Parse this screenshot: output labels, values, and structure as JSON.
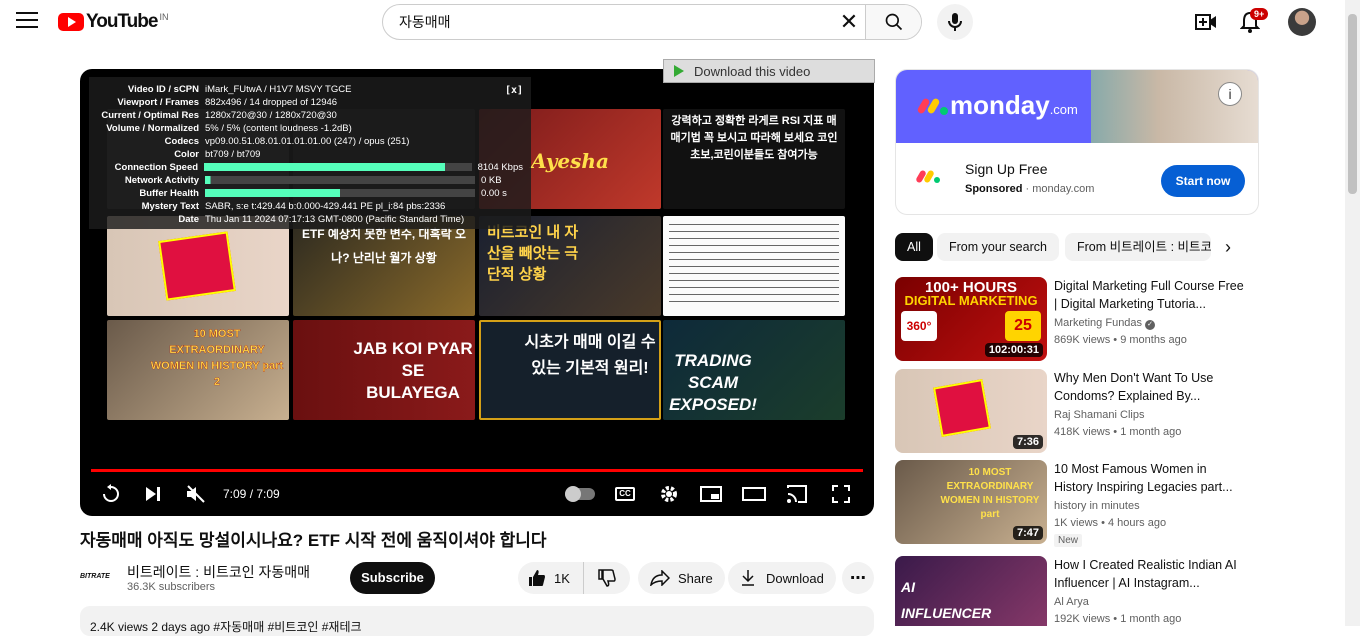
{
  "header": {
    "logo_text": "YouTube",
    "country": "IN",
    "search_value": "자동매매",
    "notification_count": "9+"
  },
  "player": {
    "stats": [
      {
        "key": "Video ID / sCPN",
        "val": "iMark_FUtwA / H1V7 MSVY TGCE"
      },
      {
        "key": "Viewport / Frames",
        "val": "882x496 / 14 dropped of 12946"
      },
      {
        "key": "Current / Optimal Res",
        "val": "1280x720@30 / 1280x720@30"
      },
      {
        "key": "Volume / Normalized",
        "val": "5% / 5% (content loudness -1.2dB)"
      },
      {
        "key": "Codecs",
        "val": "vp09.00.51.08.01.01.01.01.00 (247) / opus (251)"
      },
      {
        "key": "Color",
        "val": "bt709 / bt709"
      },
      {
        "key": "Connection Speed",
        "val": "8104 Kbps"
      },
      {
        "key": "Network Activity",
        "val": "0 KB"
      },
      {
        "key": "Buffer Health",
        "val": "0.00 s"
      },
      {
        "key": "Mystery Text",
        "val": "SABR, s:e t:429.44 b:0.000-429.441 PE pl_i:84 pbs:2336"
      },
      {
        "key": "Date",
        "val": "Thu Jan 11 2024 07:17:13 GMT-0800 (Pacific Standard Time)"
      }
    ],
    "stats_close": "[x]",
    "download_bar": "Download this video",
    "time": "7:09 / 7:09",
    "end_screen": [
      {
        "text": "강력하고 정확한 라게르 RSI 지표 매매기법 꼭 보시고 따라해 보세요 코인초보,코린이분들도 참여가능"
      },
      {
        "text": "ETF 예상치 못한 변수, 대혹락 오나? 난리난 월가 상황"
      },
      {
        "text": "비트코인 내 자산을 빼앗는 극단적 상황"
      },
      {
        "text": "10 MOST EXTRAORDINARY WOMEN IN HISTORY part 2"
      },
      {
        "text": "JAB KOI PYAR SE BULAYEGA"
      },
      {
        "text": "시초가 매매 이길 수 있는 기본적 원리!"
      },
      {
        "text": "TRADING SCAM EXPOSED!"
      }
    ]
  },
  "video": {
    "title": "자동매매 아직도 망설이시나요? ETF 시작 전에 움직이셔야 합니다",
    "channel_logo": "BITRATE",
    "channel": "비트레이트 : 비트코인 자동매매",
    "subscribers": "36.3K subscribers",
    "subscribe_label": "Subscribe",
    "likes": "1K",
    "share_label": "Share",
    "download_label": "Download",
    "description_peek": "2.4K views  2 days ago  #자동매매 #비트코인 #재테크"
  },
  "ad": {
    "brand": "monday",
    "brand_suffix": ".com",
    "title": "Sign Up Free",
    "sponsored": "Sponsored",
    "domain": "monday.com",
    "cta": "Start now"
  },
  "chips": [
    "All",
    "From your search",
    "From 비트레이트 : 비트코"
  ],
  "recommendations": [
    {
      "title": "Digital Marketing Full Course Free | Digital Marketing Tutoria...",
      "channel": "Marketing Fundas",
      "meta": "869K views • 9 months ago",
      "duration": "102:00:31",
      "thumb_top": "100+ HOURS",
      "thumb_mid": "DIGITAL MARKETING",
      "badge_a": "360°",
      "badge_b": "25"
    },
    {
      "title": "Why Men Don't Want To Use Condoms? Explained By...",
      "channel": "Raj Shamani Clips",
      "meta": "418K views • 1 month ago",
      "duration": "7:36"
    },
    {
      "title": "10 Most Famous Women in History Inspiring Legacies part...",
      "channel": "history in minutes",
      "meta": "1K views • 4 hours ago",
      "duration": "7:47",
      "new": "New",
      "thumb_text": "10 MOST EXTRAORDINARY WOMEN IN HISTORY part"
    },
    {
      "title": "How I Created Realistic Indian AI Influencer | AI Instagram...",
      "channel": "Al Arya",
      "meta": "192K views • 1 month ago",
      "thumb_text": "AI INFLUENCER"
    }
  ]
}
